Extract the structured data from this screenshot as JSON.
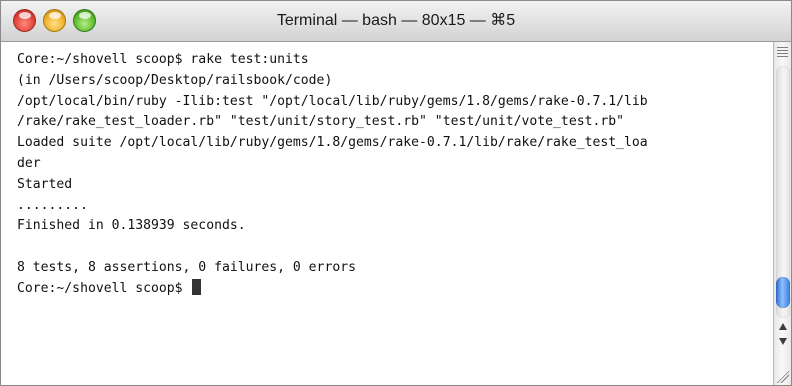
{
  "window": {
    "title": "Terminal — bash — 80x15 — ⌘5"
  },
  "terminal": {
    "lines": [
      "Core:~/shovell scoop$ rake test:units",
      "(in /Users/scoop/Desktop/railsbook/code)",
      "/opt/local/bin/ruby -Ilib:test \"/opt/local/lib/ruby/gems/1.8/gems/rake-0.7.1/lib",
      "/rake/rake_test_loader.rb\" \"test/unit/story_test.rb\" \"test/unit/vote_test.rb\"",
      "Loaded suite /opt/local/lib/ruby/gems/1.8/gems/rake-0.7.1/lib/rake/rake_test_loa",
      "der",
      "Started",
      ".........",
      "Finished in 0.138939 seconds.",
      "",
      "8 tests, 8 assertions, 0 failures, 0 errors",
      "Core:~/shovell scoop$ "
    ]
  },
  "icons": {
    "close": "close-button",
    "minimize": "minimize-button",
    "zoom": "zoom-button",
    "split": "split-handle-icon",
    "up": "scroll-up-icon",
    "down": "scroll-down-icon",
    "resize": "resize-grip-icon"
  },
  "colors": {
    "close": "#e0443a",
    "minimize": "#f0b12b",
    "zoom": "#5fbf2f",
    "scroll_thumb": "#3c7cde"
  }
}
